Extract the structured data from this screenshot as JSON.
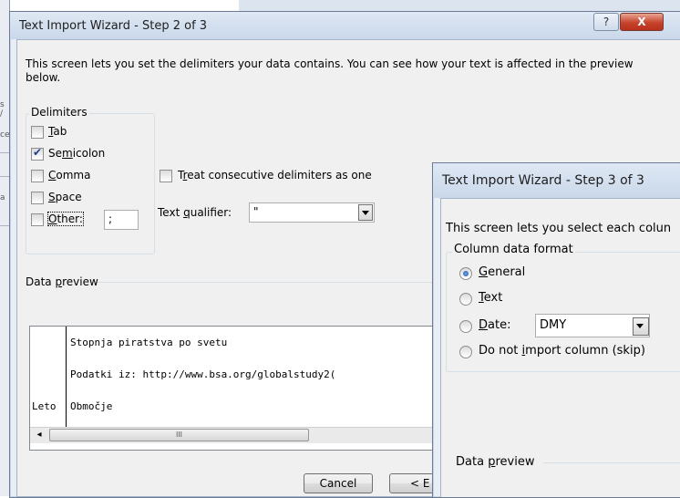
{
  "background": {
    "fragments": [
      "s /",
      "ce",
      "a"
    ]
  },
  "step2": {
    "title": "Text Import Wizard - Step 2 of 3",
    "help_glyph": "?",
    "close_glyph": "X",
    "description": "This screen lets you set the delimiters your data contains.  You can see how your text is affected in the preview below.",
    "delimiters_label": "Delimiters",
    "delimiters": [
      {
        "key": "T",
        "rest": "ab",
        "prefix": "",
        "checked": false
      },
      {
        "key": "m",
        "prefix": "Se",
        "rest": "icolon",
        "checked": true
      },
      {
        "key": "C",
        "prefix": "",
        "rest": "omma",
        "checked": false
      },
      {
        "key": "S",
        "prefix": "",
        "rest": "pace",
        "checked": false
      },
      {
        "key": "O",
        "prefix": "",
        "rest": "ther:",
        "checked": false
      }
    ],
    "other_value": ";",
    "consecutive": {
      "prefix": "T",
      "key": "r",
      "rest": "eat consecutive delimiters as one",
      "checked": false
    },
    "qualifier": {
      "prefix": "Text ",
      "key": "q",
      "rest": "ualifier:",
      "value": "\""
    },
    "preview_label_prefix": "Data ",
    "preview_label_key": "p",
    "preview_label_rest": "review",
    "preview_lines": [
      {
        "col1": "",
        "col2": "Stopnja piratstva po svetu"
      },
      {
        "col1": "",
        "col2": "Podatki iz: http://www.bsa.org/globalstudy2("
      },
      {
        "col1": "Leto",
        "col2": "Območje"
      }
    ],
    "scroll_left": "◂",
    "scroll_grip": "III",
    "cancel_label": "Cancel",
    "back_label": "< E"
  },
  "step3": {
    "title": "Text Import Wizard - Step 3 of 3",
    "description": "This screen lets you select each colun",
    "format_label": "Column data format",
    "options": [
      {
        "prefix": "",
        "key": "G",
        "rest": "eneral",
        "checked": true
      },
      {
        "prefix": "",
        "key": "T",
        "rest": "ext",
        "checked": false
      },
      {
        "prefix": "",
        "key": "D",
        "rest": "ate:",
        "checked": false
      },
      {
        "prefix": "Do not ",
        "key": "i",
        "rest": "mport column (skip)",
        "checked": false
      }
    ],
    "date_format": "DMY",
    "preview_label_prefix": "Data ",
    "preview_label_key": "p",
    "preview_label_rest": "review"
  }
}
